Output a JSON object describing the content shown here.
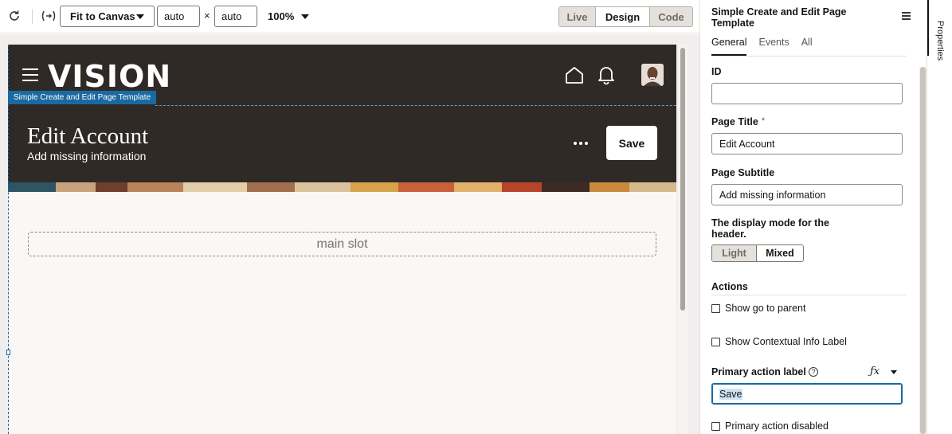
{
  "toolbar": {
    "fit_label": "Fit to Canvas",
    "width_value": "auto",
    "height_value": "auto",
    "times_symbol": "×",
    "zoom": "100%",
    "modes": [
      "Live",
      "Design",
      "Code"
    ],
    "active_mode": "Design"
  },
  "preview": {
    "logo": "VISION",
    "template_tag": "Simple Create and Edit Page Template",
    "title": "Edit Account",
    "subtitle": "Add missing information",
    "save_label": "Save",
    "main_slot": "main slot",
    "header_bg": "#302a26",
    "accent": "#1a6aa1"
  },
  "panel": {
    "title": "Simple Create and Edit Page Template",
    "tabs": [
      "General",
      "Events",
      "All"
    ],
    "active_tab": "General",
    "id_label": "ID",
    "id_value": "",
    "page_title_label": "Page Title",
    "required_mark": "*",
    "page_title_value": "Edit Account",
    "page_subtitle_label": "Page Subtitle",
    "page_subtitle_value": "Add missing information",
    "display_mode_label": "The display mode for the header.",
    "display_modes": [
      "Light",
      "Mixed"
    ],
    "display_mode_selected": "Mixed",
    "actions_label": "Actions",
    "show_go_to_parent": "Show go to parent",
    "show_contextual_info": "Show Contextual Info Label",
    "primary_action_label": "Primary action label",
    "help_symbol": "?",
    "fx_symbol": "ƒx",
    "primary_action_value": "Save",
    "primary_action_disabled": "Primary action disabled"
  },
  "side": {
    "properties_tab": "Properties"
  }
}
